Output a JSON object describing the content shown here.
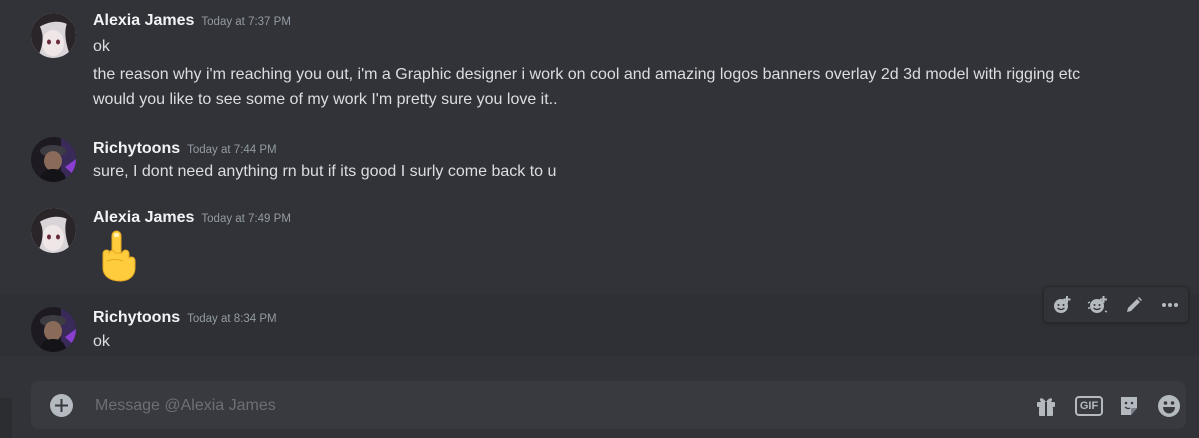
{
  "messages": [
    {
      "username": "Alexia James",
      "timestamp": "Today at 7:37 PM",
      "lines": [
        "ok",
        "the reason why i'm reaching you out, i'm a Graphic designer i work on cool and amazing logos banners overlay 2d 3d model with rigging etc",
        "would you like to see some of my work I'm pretty sure you love it.."
      ]
    },
    {
      "username": "Richytoons",
      "timestamp": "Today at 7:44 PM",
      "lines": [
        "sure, I dont need anything rn but if its good I surly come back to u"
      ]
    },
    {
      "username": "Alexia James",
      "timestamp": "Today at 7:49 PM",
      "emoji": "middle-finger-emoji"
    },
    {
      "username": "Richytoons",
      "timestamp": "Today at 8:34 PM",
      "lines": [
        "ok"
      ]
    }
  ],
  "message_actions": [
    "add-reaction-icon",
    "super-reaction-icon",
    "edit-icon",
    "more-icon"
  ],
  "composer": {
    "placeholder": "Message @Alexia James",
    "gif_label": "GIF",
    "icons": [
      "add-icon",
      "gift-icon",
      "gif-icon",
      "sticker-icon",
      "emoji-icon"
    ]
  },
  "colors": {
    "background": "#313338",
    "composer_bg": "#383a40",
    "hover_bg": "#2e3035",
    "username": "#f2f3f5",
    "timestamp": "#949ba4",
    "text": "#dbdee1",
    "icon": "#b5bac1"
  }
}
